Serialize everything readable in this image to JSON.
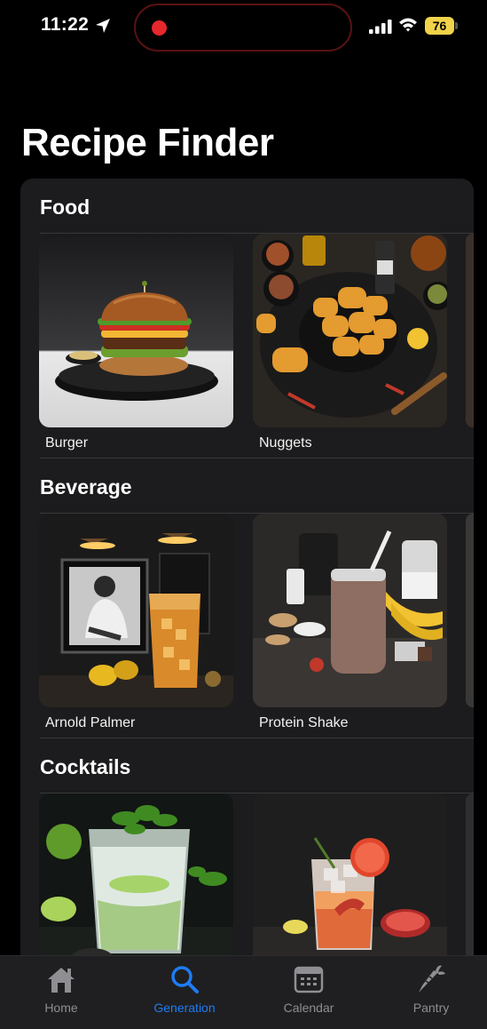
{
  "status_bar": {
    "time": "11:22",
    "battery": "76"
  },
  "title": "Recipe Finder",
  "sections": [
    {
      "title": "Food",
      "items": [
        {
          "label": "Burger"
        },
        {
          "label": "Nuggets"
        }
      ]
    },
    {
      "title": "Beverage",
      "items": [
        {
          "label": "Arnold Palmer"
        },
        {
          "label": "Protein Shake"
        }
      ]
    },
    {
      "title": "Cocktails",
      "items": [
        {
          "label": ""
        },
        {
          "label": ""
        }
      ]
    }
  ],
  "tabs": [
    {
      "label": "Home",
      "icon": "house-icon",
      "active": false
    },
    {
      "label": "Generation",
      "icon": "magnifying-glass-icon",
      "active": true
    },
    {
      "label": "Calendar",
      "icon": "calendar-icon",
      "active": false
    },
    {
      "label": "Pantry",
      "icon": "carrot-icon",
      "active": false
    }
  ],
  "colors": {
    "accent": "#1e7cf5",
    "background": "#000000",
    "card": "#1c1c1e",
    "battery": "#f1d34b",
    "recording": "#e5282e"
  }
}
